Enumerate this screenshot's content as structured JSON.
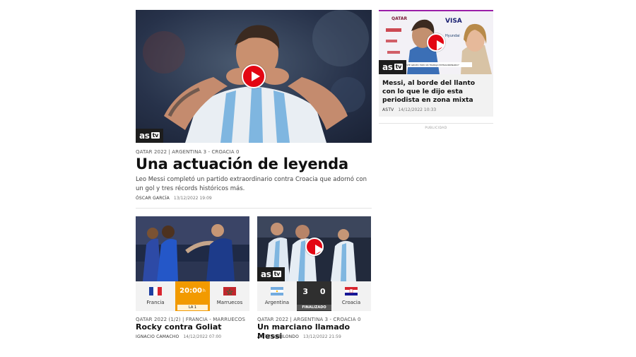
{
  "hero": {
    "kicker": "QATAR 2022 | ARGENTINA 3 - CROACIA 0",
    "title": "Una actuación de leyenda",
    "summary": "Leo Messi completó un partido extraordinario contra Croacia que adornó con un gol y tres récords históricos más.",
    "author": "ÓSCAR GARCÍA",
    "date": "13/12/2022",
    "time": "19:09",
    "badge_brand": "as",
    "badge_tv": "tv",
    "icon": "play-icon"
  },
  "cards": [
    {
      "kicker": "QATAR 2022 (1/2) | FRANCIA - MARRUECOS",
      "title": "Rocky contra Goliat",
      "author": "IGNACIO CAMACHO",
      "date": "14/12/2022",
      "time": "07:00",
      "home_team": "Francia",
      "away_team": "Marruecos",
      "match_time": "20:00",
      "match_time_suffix": "h",
      "channel": "LA 1",
      "colors": {
        "center": "#f29a00"
      }
    },
    {
      "kicker": "QATAR 2022 | ARGENTINA 3 - CROACIA 0",
      "title": "Un marciano llamado Messi",
      "author": "ARITZ GABILONDO",
      "date": "13/12/2022",
      "time": "21:59",
      "home_team": "Argentina",
      "away_team": "Croacia",
      "home_score": "3",
      "away_score": "0",
      "status": "FINALIZADO",
      "badge_brand": "as",
      "badge_tv": "tv",
      "colors": {
        "center": "#2f2f2f"
      }
    }
  ],
  "side": {
    "title": "Messi, al borde del llanto con lo que le dijo esta periodista en zona mixta",
    "source": "ASTV",
    "date": "14/12/2022",
    "time": "10:33",
    "badge_brand": "as",
    "badge_tv": "tv",
    "ad_label": "PUBLICIDAD",
    "backdrop_logos": [
      "QATAR",
      "VISA",
      "Hyundai"
    ],
    "lower_third": "\"ESTE GRUPO HIZO UN TRABAJO EXTRAORDINARIO\"",
    "colors": {
      "accent": "#9b1fa8"
    }
  },
  "colors": {
    "play": "#e30613",
    "badge": "#1d1d1d"
  }
}
